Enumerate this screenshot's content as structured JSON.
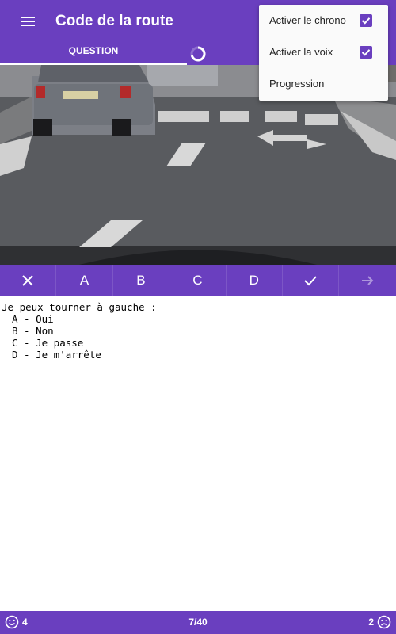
{
  "app": {
    "title": "Code de la route"
  },
  "tabs": [
    {
      "label": "QUESTION"
    }
  ],
  "answer_bar": {
    "options": [
      "A",
      "B",
      "C",
      "D"
    ]
  },
  "question": {
    "prompt": "Je peux tourner à gauche :",
    "options": [
      "A - Oui",
      "B - Non",
      "C - Je passe",
      "D - Je m'arrête"
    ]
  },
  "menu": {
    "items": [
      {
        "label": "Activer le chrono",
        "checked": true
      },
      {
        "label": "Activer la voix",
        "checked": true
      },
      {
        "label": "Progression"
      }
    ]
  },
  "footer": {
    "correct_count": "4",
    "progress": "7/40",
    "wrong_count": "2"
  },
  "colors": {
    "primary": "#6a3fbf",
    "on_primary": "#ffffff"
  }
}
